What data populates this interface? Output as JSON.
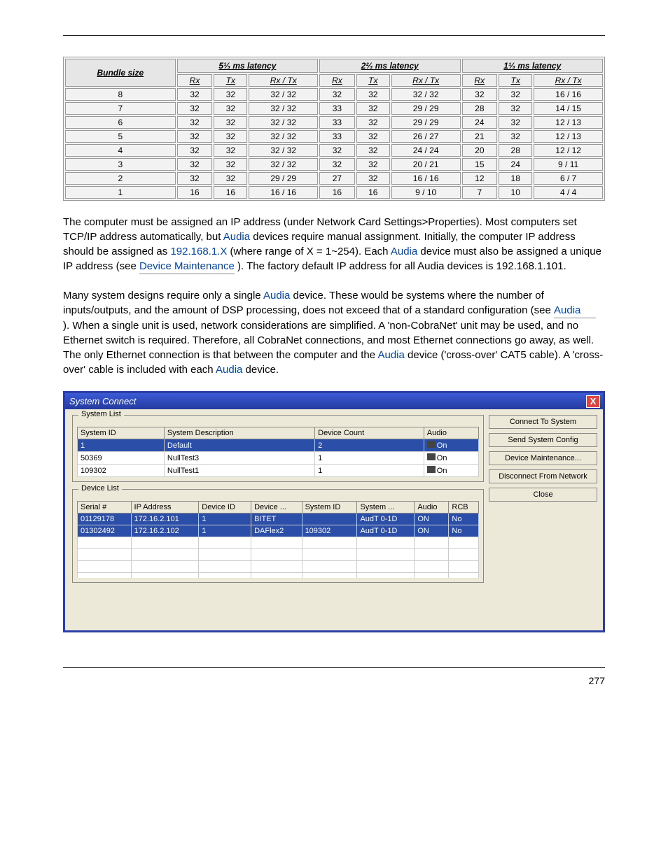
{
  "page": {
    "number": "277"
  },
  "latency_table": {
    "col_bundle": "Bundle size",
    "groups": [
      "5⅓ ms latency",
      "2⅔ ms latency",
      "1⅓ ms latency"
    ],
    "sub": [
      "Rx",
      "Tx",
      "Rx / Tx"
    ],
    "rows": [
      {
        "b": "8",
        "a": [
          "32",
          "32",
          "32 / 32"
        ],
        "c": [
          "32",
          "32",
          "32 / 32"
        ],
        "d": [
          "32",
          "32",
          "16 / 16"
        ]
      },
      {
        "b": "7",
        "a": [
          "32",
          "32",
          "32 / 32"
        ],
        "c": [
          "33",
          "32",
          "29 / 29"
        ],
        "d": [
          "28",
          "32",
          "14 / 15"
        ]
      },
      {
        "b": "6",
        "a": [
          "32",
          "32",
          "32 / 32"
        ],
        "c": [
          "33",
          "32",
          "29 / 29"
        ],
        "d": [
          "24",
          "32",
          "12 / 13"
        ]
      },
      {
        "b": "5",
        "a": [
          "32",
          "32",
          "32 / 32"
        ],
        "c": [
          "33",
          "32",
          "26 / 27"
        ],
        "d": [
          "21",
          "32",
          "12 / 13"
        ]
      },
      {
        "b": "4",
        "a": [
          "32",
          "32",
          "32 / 32"
        ],
        "c": [
          "32",
          "32",
          "24 / 24"
        ],
        "d": [
          "20",
          "28",
          "12 / 12"
        ]
      },
      {
        "b": "3",
        "a": [
          "32",
          "32",
          "32 / 32"
        ],
        "c": [
          "32",
          "32",
          "20 / 21"
        ],
        "d": [
          "15",
          "24",
          "9 / 11"
        ]
      },
      {
        "b": "2",
        "a": [
          "32",
          "32",
          "29 / 29"
        ],
        "c": [
          "27",
          "32",
          "16 / 16"
        ],
        "d": [
          "12",
          "18",
          "6 / 7"
        ]
      },
      {
        "b": "1",
        "a": [
          "16",
          "16",
          "16 / 16"
        ],
        "c": [
          "16",
          "16",
          "9 / 10"
        ],
        "d": [
          "7",
          "10",
          "4 / 4"
        ]
      }
    ]
  },
  "text": {
    "p1a": "The computer must be assigned an IP address (under Network Card Settings>Properties). Most computers set TCP/IP address automatically, but ",
    "p1b": " devices require manual assignment. Initially, the computer IP address should be assigned as ",
    "p1c": " (where range of X = 1~254). Each ",
    "p1d": " device must also be assigned a unique IP address (see ",
    "p1e": "). The factory default IP address for all Audia devices is 192.168.1.101.",
    "p2a": "Many system designs require only a single ",
    "p2b": " device. These would be systems where the number of inputs/outputs, and the amount of DSP processing, does not exceed that of a standard configuration (see ",
    "p2c": "). When a single unit is used, network considerations are simplified. A 'non-CobraNet' unit may be used, and no Ethernet switch is required. Therefore, all CobraNet connections, and most Ethernet connections go away, as well. The only Ethernet connection is that between the computer and the ",
    "p2d": " device ('cross-over' CAT5 cable). A 'cross-over' cable is included with each ",
    "p2e": " device.",
    "link_audia1": "Audia",
    "link_ip": "192.168.1.X",
    "link_audia2": "Audia",
    "link_device_maint": "Device Maintenance",
    "link_audia3": "Audia",
    "link_audia4": "Audia",
    "link_audia5": "Audia",
    "link_audia6": "Audia"
  },
  "dialog": {
    "title": "System Connect",
    "close_x": "X",
    "buttons": {
      "connect": "Connect To System",
      "send": "Send System Config",
      "maint": "Device Maintenance...",
      "disconnect": "Disconnect From Network",
      "close": "Close"
    },
    "system_list": {
      "title": "System List",
      "headers": [
        "System ID",
        "System Description",
        "Device Count",
        "Audio"
      ],
      "rows": [
        {
          "id": "1",
          "desc": "Default",
          "count": "2",
          "audio": "On",
          "sel": true
        },
        {
          "id": "50369",
          "desc": "NullTest3",
          "count": "1",
          "audio": "On",
          "sel": false
        },
        {
          "id": "109302",
          "desc": "NullTest1",
          "count": "1",
          "audio": "On",
          "sel": false
        }
      ]
    },
    "device_list": {
      "title": "Device List",
      "headers": [
        "Serial #",
        "IP Address",
        "Device ID",
        "Device ...",
        "System ID",
        "System ...",
        "Audio",
        "RCB"
      ],
      "rows": [
        {
          "sn": "01129178",
          "ip": "172.16.2.101",
          "did": "1",
          "dd": "BITET",
          "sid": "",
          "sd": "AudT 0-1D",
          "au": "ON",
          "rcb": "No",
          "sel": true
        },
        {
          "sn": "01302492",
          "ip": "172.16.2.102",
          "did": "1",
          "dd": "DAFlex2",
          "sid": "109302",
          "sd": "AudT 0-1D",
          "au": "ON",
          "rcb": "No",
          "sel": true
        }
      ]
    }
  },
  "chart_data": {
    "type": "table",
    "title": "Bundle size vs latency (Rx / Tx counts)",
    "columns": [
      "Bundle size",
      "5⅓ ms Rx",
      "5⅓ ms Tx",
      "5⅓ ms Rx/Tx",
      "2⅔ ms Rx",
      "2⅔ ms Tx",
      "2⅔ ms Rx/Tx",
      "1⅓ ms Rx",
      "1⅓ ms Tx",
      "1⅓ ms Rx/Tx"
    ],
    "rows": [
      [
        8,
        32,
        32,
        "32/32",
        32,
        32,
        "32/32",
        32,
        32,
        "16/16"
      ],
      [
        7,
        32,
        32,
        "32/32",
        33,
        32,
        "29/29",
        28,
        32,
        "14/15"
      ],
      [
        6,
        32,
        32,
        "32/32",
        33,
        32,
        "29/29",
        24,
        32,
        "12/13"
      ],
      [
        5,
        32,
        32,
        "32/32",
        33,
        32,
        "26/27",
        21,
        32,
        "12/13"
      ],
      [
        4,
        32,
        32,
        "32/32",
        32,
        32,
        "24/24",
        20,
        28,
        "12/12"
      ],
      [
        3,
        32,
        32,
        "32/32",
        32,
        32,
        "20/21",
        15,
        24,
        "9/11"
      ],
      [
        2,
        32,
        32,
        "29/29",
        27,
        32,
        "16/16",
        12,
        18,
        "6/7"
      ],
      [
        1,
        16,
        16,
        "16/16",
        16,
        16,
        "9/10",
        7,
        10,
        "4/4"
      ]
    ]
  }
}
